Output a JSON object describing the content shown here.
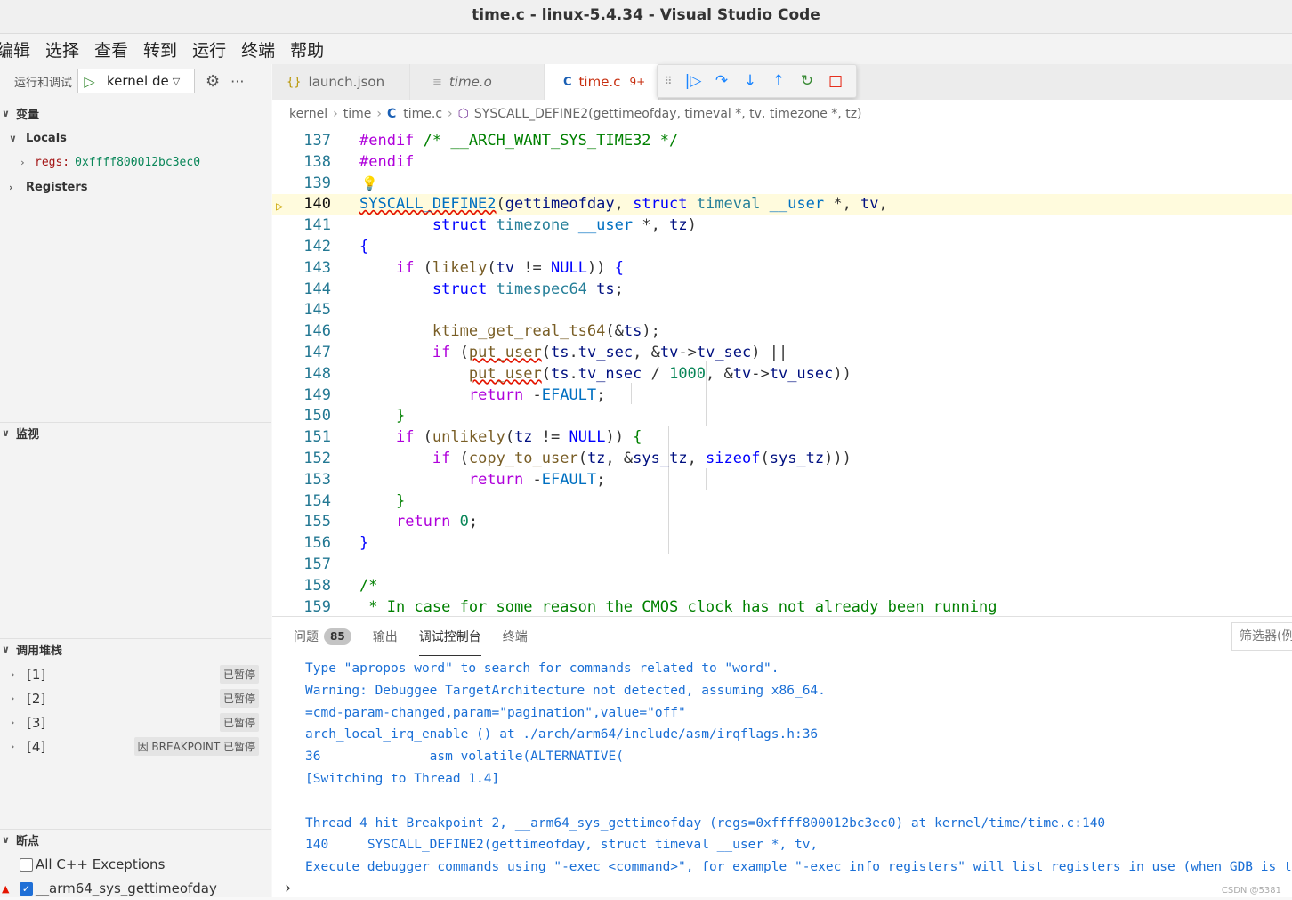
{
  "window": {
    "title": "time.c - linux-5.4.34 - Visual Studio Code"
  },
  "menu": [
    "编辑",
    "选择",
    "查看",
    "转到",
    "运行",
    "终端",
    "帮助"
  ],
  "run": {
    "label": "运行和调试",
    "config": "kernel de"
  },
  "sections": {
    "variables": "变量",
    "locals": "Locals",
    "regs_name": "regs:",
    "regs_value": "0xffff800012bc3ec0",
    "registers": "Registers",
    "watch": "监视",
    "callstack": "调用堆栈",
    "breakpoints": "断点"
  },
  "callstack": [
    {
      "label": "[1]",
      "status": "已暂停"
    },
    {
      "label": "[2]",
      "status": "已暂停"
    },
    {
      "label": "[3]",
      "status": "已暂停"
    },
    {
      "label": "[4]",
      "status": "因 BREAKPOINT 已暂停"
    }
  ],
  "breakpoints": [
    {
      "label": "All C++ Exceptions",
      "checked": false
    },
    {
      "label": "__arm64_sys_gettimeofday",
      "checked": true
    }
  ],
  "tabs": [
    {
      "icon": "{}",
      "label": "launch.json"
    },
    {
      "icon": "≡",
      "label": "time.o"
    },
    {
      "icon": "C",
      "label": "time.c",
      "badge": "9+"
    }
  ],
  "breadcrumb": {
    "p1": "kernel",
    "p2": "time",
    "p3": "time.c",
    "p4": "SYSCALL_DEFINE2(gettimeofday, timeval *, tv, timezone *, tz)"
  },
  "line_numbers": [
    "137",
    "138",
    "139",
    "140",
    "141",
    "142",
    "143",
    "144",
    "145",
    "146",
    "147",
    "148",
    "149",
    "150",
    "151",
    "152",
    "153",
    "154",
    "155",
    "156",
    "157",
    "158",
    "159"
  ],
  "panel": {
    "tabs": [
      "问题",
      "输出",
      "调试控制台",
      "终端"
    ],
    "problem_count": "85",
    "filter_placeholder": "筛选器(例"
  },
  "console": [
    "Type \"apropos word\" to search for commands related to \"word\".",
    "Warning: Debuggee TargetArchitecture not detected, assuming x86_64.",
    "=cmd-param-changed,param=\"pagination\",value=\"off\"",
    "arch_local_irq_enable () at ./arch/arm64/include/asm/irqflags.h:36",
    "36              asm volatile(ALTERNATIVE(",
    "[Switching to Thread 1.4]",
    "",
    "Thread 4 hit Breakpoint 2, __arm64_sys_gettimeofday (regs=0xffff800012bc3ec0) at kernel/time/time.c:140",
    "140     SYSCALL_DEFINE2(gettimeofday, struct timeval __user *, tv,",
    "Execute debugger commands using \"-exec <command>\", for example \"-exec info registers\" will list registers in use (when GDB is t"
  ],
  "watermark": "CSDN @5381"
}
